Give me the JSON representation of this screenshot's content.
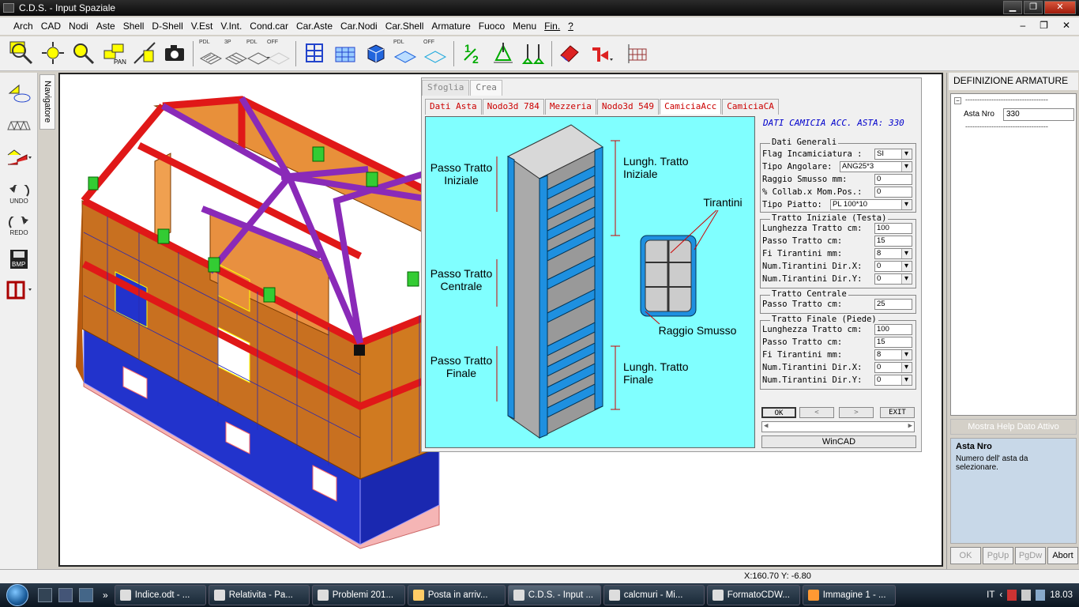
{
  "window": {
    "title": "C.D.S. - Input Spaziale"
  },
  "menu": [
    "Arch",
    "CAD",
    "Nodi",
    "Aste",
    "Shell",
    "D-Shell",
    "V.Est",
    "V.Int.",
    "Cond.car",
    "Car.Aste",
    "Car.Nodi",
    "Car.Shell",
    "Armature",
    "Fuoco",
    "Menu",
    "Fin.",
    "?"
  ],
  "toolbar": {
    "labels": {
      "pan": "PAN",
      "pdl1": "PDL",
      "p3p": "3P",
      "pdl2": "PDL",
      "off1": "OFF",
      "pdl3": "PDL",
      "off2": "OFF"
    }
  },
  "left_toolbar": {
    "undo": "UNDO",
    "redo": "REDO",
    "bmp": "BMP"
  },
  "navigator_tab": "Navigatore",
  "dialog": {
    "tabs": [
      "Sfoglia",
      "Crea"
    ],
    "subtabs": [
      "Dati Asta",
      "Nodo3d 784",
      "Mezzeria",
      "Nodo3d 549",
      "CamiciaAcc",
      "CamiciaCA"
    ],
    "image_labels": {
      "passo_iniziale": "Passo Tratto Iniziale",
      "passo_centrale": "Passo Tratto Centrale",
      "passo_finale": "Passo Tratto Finale",
      "lungh_iniziale": "Lungh. Tratto Iniziale",
      "lungh_finale": "Lungh. Tratto Finale",
      "tirantini": "Tirantini",
      "raggio_smusso": "Raggio Smusso"
    },
    "form": {
      "title": "DATI CAMICIA ACC. ASTA: 330",
      "dati_generali": {
        "title": "Dati Generali",
        "flag_label": "Flag Incamiciatura :",
        "flag_value": "SI",
        "angolare_label": "Tipo Angolare:",
        "angolare_value": "ANG25*3",
        "raggio_label": "Raggio Smusso    mm:",
        "raggio_value": "0",
        "collab_label": "% Collab.x Mom.Pos.:",
        "collab_value": "0",
        "piatto_label": "Tipo Piatto:",
        "piatto_value": "PL 100*10"
      },
      "tratto_iniziale": {
        "title": "Tratto Iniziale (Testa)",
        "lungh_label": "Lunghezza Tratto cm:",
        "lungh_value": "100",
        "passo_label": "Passo Tratto     cm:",
        "passo_value": "15",
        "fi_label": "Fi Tirantini     mm:",
        "fi_value": "8",
        "numx_label": "Num.Tirantini Dir.X:",
        "numx_value": "0",
        "numy_label": "Num.Tirantini Dir.Y:",
        "numy_value": "0"
      },
      "tratto_centrale": {
        "title": "Tratto Centrale",
        "passo_label": "Passo Tratto     cm:",
        "passo_value": "25"
      },
      "tratto_finale": {
        "title": "Tratto Finale (Piede)",
        "lungh_label": "Lunghezza Tratto cm:",
        "lungh_value": "100",
        "passo_label": "Passo Tratto     cm:",
        "passo_value": "15",
        "fi_label": "Fi Tirantini     mm:",
        "fi_value": "8",
        "numx_label": "Num.Tirantini Dir.X:",
        "numx_value": "0",
        "numy_label": "Num.Tirantini Dir.Y:",
        "numy_value": "0"
      },
      "buttons": {
        "ok": "OK",
        "prev": "<",
        "next": ">",
        "exit": "EXIT"
      },
      "wincad": "WinCAD"
    }
  },
  "right_panel": {
    "title": "DEFINIZIONE ARMATURE ...",
    "tree": {
      "dashes": "-----------------------------------",
      "asta_label": "Asta Nro",
      "asta_value": "330"
    },
    "help_button": "Mostra Help Dato Attivo",
    "help_title": "Asta Nro",
    "help_text": "Numero dell' asta da selezionare.",
    "buttons": [
      "OK",
      "PgUp",
      "PgDw",
      "Abort"
    ]
  },
  "status": {
    "coords": "X:160.70  Y: -6.80"
  },
  "taskbar": {
    "items": [
      "Indice.odt - ...",
      "Relativita - Pa...",
      "Problemi 201...",
      "Posta in arriv...",
      "C.D.S. - Input ...",
      "calcmuri - Mi...",
      "FormatoCDW...",
      "Immagine 1 - ..."
    ],
    "lang": "IT",
    "clock": "18.03"
  }
}
